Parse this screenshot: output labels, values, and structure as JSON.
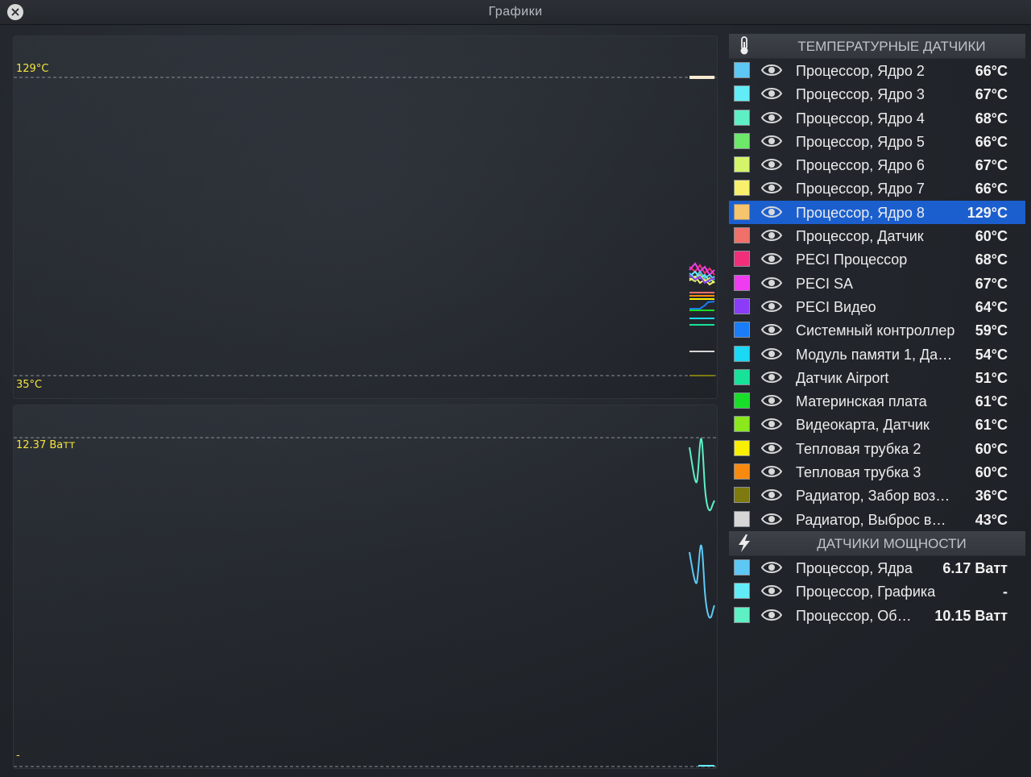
{
  "window": {
    "title": "Графики",
    "close_icon": "close-icon"
  },
  "temp_graph": {
    "max_label": "129°C",
    "min_label": "35°C"
  },
  "power_graph": {
    "max_label": "12.37 Ватт",
    "min_label": "-"
  },
  "temp_section": {
    "title": "ТЕМПЕРАТУРНЫЕ ДАТЧИКИ",
    "icon": "thermometer-icon",
    "sensors": [
      {
        "name": "Процессор, Ядро 2",
        "value": "66°C",
        "color": "#5ec8f5"
      },
      {
        "name": "Процессор, Ядро 3",
        "value": "67°C",
        "color": "#62ecf7"
      },
      {
        "name": "Процессор, Ядро 4",
        "value": "68°C",
        "color": "#5ef0c4"
      },
      {
        "name": "Процессор, Ядро 5",
        "value": "66°C",
        "color": "#6ee86a"
      },
      {
        "name": "Процессор, Ядро 6",
        "value": "67°C",
        "color": "#d4f56a"
      },
      {
        "name": "Процессор, Ядро 7",
        "value": "66°C",
        "color": "#f8f06c"
      },
      {
        "name": "Процессор, Ядро 8",
        "value": "129°C",
        "color": "#f6c46c"
      },
      {
        "name": "Процессор, Датчик",
        "value": "60°C",
        "color": "#f0706a"
      },
      {
        "name": "PECI Процессор",
        "value": "68°C",
        "color": "#f02e7a"
      },
      {
        "name": "PECI SA",
        "value": "67°C",
        "color": "#f03cf0"
      },
      {
        "name": "PECI Видео",
        "value": "64°C",
        "color": "#8a3cf8"
      },
      {
        "name": "Системный контроллер",
        "value": "59°C",
        "color": "#1a7cf6"
      },
      {
        "name": "Модуль памяти 1, Да…",
        "value": "54°C",
        "color": "#1ad8f6"
      },
      {
        "name": "Датчик Airport",
        "value": "51°C",
        "color": "#18e29a"
      },
      {
        "name": "Материнская плата",
        "value": "61°C",
        "color": "#18de2a"
      },
      {
        "name": "Видеокарта, Датчик",
        "value": "61°C",
        "color": "#8ae81c"
      },
      {
        "name": "Тепловая трубка 2",
        "value": "60°C",
        "color": "#f8f000"
      },
      {
        "name": "Тепловая трубка 3",
        "value": "60°C",
        "color": "#f88a10"
      },
      {
        "name": "Радиатор, Забор воз…",
        "value": "36°C",
        "color": "#7e7a10"
      },
      {
        "name": "Радиатор, Выброс в…",
        "value": "43°C",
        "color": "#d6d6d6"
      }
    ]
  },
  "power_section": {
    "title": "ДАТЧИКИ МОЩНОСТИ",
    "icon": "lightning-icon",
    "sensors": [
      {
        "name": "Процессор, Ядра",
        "value": "6.17 Ватт",
        "color": "#5ec8f5"
      },
      {
        "name": "Процессор, Графика",
        "value": "-",
        "color": "#62ecf7"
      },
      {
        "name": "Процессор, Об…",
        "value": "10.15 Ватт",
        "color": "#5ef0c4"
      }
    ]
  },
  "selected_sensor": "Процессор, Ядро 8"
}
